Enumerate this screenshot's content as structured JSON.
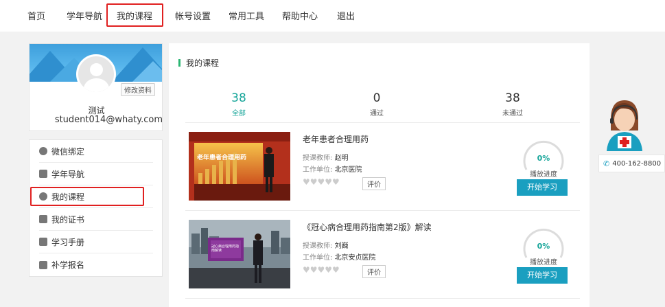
{
  "nav": {
    "items": [
      "首页",
      "学年导航",
      "我的课程",
      "帐号设置",
      "常用工具",
      "帮助中心",
      "退出"
    ]
  },
  "profile": {
    "edit_label": "修改资料",
    "name": "测试",
    "email": "student014@whaty.com"
  },
  "sidebar": {
    "items": [
      {
        "label": "微信绑定",
        "icon": "wechat-icon"
      },
      {
        "label": "学年导航",
        "icon": "book-icon"
      },
      {
        "label": "我的课程",
        "icon": "course-icon"
      },
      {
        "label": "我的证书",
        "icon": "certificate-icon"
      },
      {
        "label": "学习手册",
        "icon": "manual-icon"
      },
      {
        "label": "补学报名",
        "icon": "signup-icon"
      }
    ]
  },
  "main": {
    "section_title": "我的课程",
    "stats": [
      {
        "value": "38",
        "label": "全部"
      },
      {
        "value": "0",
        "label": "通过"
      },
      {
        "value": "38",
        "label": "未通过"
      }
    ],
    "teacher_label": "授课教师:",
    "unit_label": "工作单位:",
    "rate_label": "评价",
    "progress_label": "播放进度",
    "start_label": "开始学习",
    "courses": [
      {
        "title": "老年患者合理用药",
        "teacher": "赵明",
        "unit": "北京医院",
        "progress": "0%",
        "thumb_text": "老年患者合理用药"
      },
      {
        "title": "《冠心病合理用药指南第2版》解读",
        "teacher": "刘巍",
        "unit": "北京安贞医院",
        "progress": "0%",
        "thumb_text": "冠心病合理用药指南解读"
      }
    ]
  },
  "service": {
    "phone": "400-162-8800"
  },
  "colors": {
    "accent": "#18a69a",
    "button": "#1a9fc0",
    "highlight": "#e02020"
  }
}
